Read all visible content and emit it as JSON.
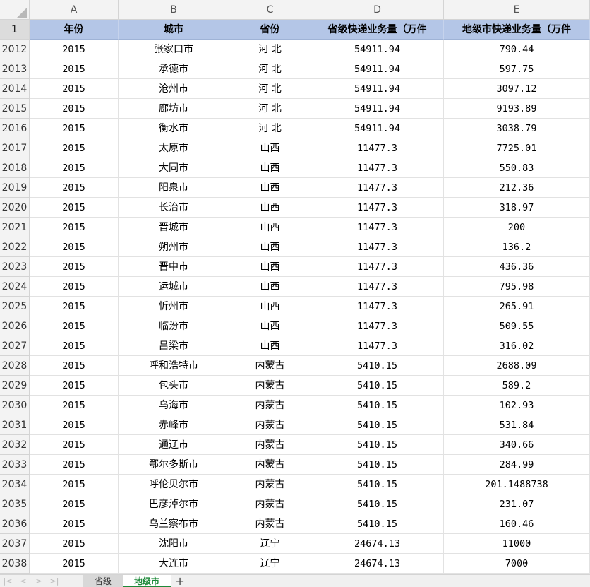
{
  "columns": [
    "A",
    "B",
    "C",
    "D",
    "E"
  ],
  "header": {
    "row_number": "1",
    "cells": [
      "年份",
      "城市",
      "省份",
      "省级快递业务量（万件",
      "地级市快递业务量（万件"
    ]
  },
  "rows": [
    {
      "n": "2012",
      "year": "2015",
      "city": "张家口市",
      "province": "河  北",
      "prov_volume": "54911.94",
      "city_volume": "790.44"
    },
    {
      "n": "2013",
      "year": "2015",
      "city": "承德市",
      "province": "河  北",
      "prov_volume": "54911.94",
      "city_volume": "597.75"
    },
    {
      "n": "2014",
      "year": "2015",
      "city": "沧州市",
      "province": "河  北",
      "prov_volume": "54911.94",
      "city_volume": "3097.12"
    },
    {
      "n": "2015",
      "year": "2015",
      "city": "廊坊市",
      "province": "河  北",
      "prov_volume": "54911.94",
      "city_volume": "9193.89"
    },
    {
      "n": "2016",
      "year": "2015",
      "city": "衡水市",
      "province": "河  北",
      "prov_volume": "54911.94",
      "city_volume": "3038.79"
    },
    {
      "n": "2017",
      "year": "2015",
      "city": "太原市",
      "province": "山西",
      "prov_volume": "11477.3",
      "city_volume": "7725.01"
    },
    {
      "n": "2018",
      "year": "2015",
      "city": "大同市",
      "province": "山西",
      "prov_volume": "11477.3",
      "city_volume": "550.83"
    },
    {
      "n": "2019",
      "year": "2015",
      "city": "阳泉市",
      "province": "山西",
      "prov_volume": "11477.3",
      "city_volume": "212.36"
    },
    {
      "n": "2020",
      "year": "2015",
      "city": "长治市",
      "province": "山西",
      "prov_volume": "11477.3",
      "city_volume": "318.97"
    },
    {
      "n": "2021",
      "year": "2015",
      "city": "晋城市",
      "province": "山西",
      "prov_volume": "11477.3",
      "city_volume": "200"
    },
    {
      "n": "2022",
      "year": "2015",
      "city": "朔州市",
      "province": "山西",
      "prov_volume": "11477.3",
      "city_volume": "136.2"
    },
    {
      "n": "2023",
      "year": "2015",
      "city": "晋中市",
      "province": "山西",
      "prov_volume": "11477.3",
      "city_volume": "436.36"
    },
    {
      "n": "2024",
      "year": "2015",
      "city": "运城市",
      "province": "山西",
      "prov_volume": "11477.3",
      "city_volume": "795.98"
    },
    {
      "n": "2025",
      "year": "2015",
      "city": "忻州市",
      "province": "山西",
      "prov_volume": "11477.3",
      "city_volume": "265.91"
    },
    {
      "n": "2026",
      "year": "2015",
      "city": "临汾市",
      "province": "山西",
      "prov_volume": "11477.3",
      "city_volume": "509.55"
    },
    {
      "n": "2027",
      "year": "2015",
      "city": "吕梁市",
      "province": "山西",
      "prov_volume": "11477.3",
      "city_volume": "316.02"
    },
    {
      "n": "2028",
      "year": "2015",
      "city": "呼和浩特市",
      "province": "内蒙古",
      "prov_volume": "5410.15",
      "city_volume": "2688.09"
    },
    {
      "n": "2029",
      "year": "2015",
      "city": "包头市",
      "province": "内蒙古",
      "prov_volume": "5410.15",
      "city_volume": "589.2"
    },
    {
      "n": "2030",
      "year": "2015",
      "city": "乌海市",
      "province": "内蒙古",
      "prov_volume": "5410.15",
      "city_volume": "102.93"
    },
    {
      "n": "2031",
      "year": "2015",
      "city": "赤峰市",
      "province": "内蒙古",
      "prov_volume": "5410.15",
      "city_volume": "531.84"
    },
    {
      "n": "2032",
      "year": "2015",
      "city": "通辽市",
      "province": "内蒙古",
      "prov_volume": "5410.15",
      "city_volume": "340.66"
    },
    {
      "n": "2033",
      "year": "2015",
      "city": "鄂尔多斯市",
      "province": "内蒙古",
      "prov_volume": "5410.15",
      "city_volume": "284.99"
    },
    {
      "n": "2034",
      "year": "2015",
      "city": "呼伦贝尔市",
      "province": "内蒙古",
      "prov_volume": "5410.15",
      "city_volume": "201.1488738"
    },
    {
      "n": "2035",
      "year": "2015",
      "city": "巴彦淖尔市",
      "province": "内蒙古",
      "prov_volume": "5410.15",
      "city_volume": "231.07"
    },
    {
      "n": "2036",
      "year": "2015",
      "city": "乌兰察布市",
      "province": "内蒙古",
      "prov_volume": "5410.15",
      "city_volume": "160.46"
    },
    {
      "n": "2037",
      "year": "2015",
      "city": "沈阳市",
      "province": "辽宁",
      "prov_volume": "24674.13",
      "city_volume": "11000"
    },
    {
      "n": "2038",
      "year": "2015",
      "city": "大连市",
      "province": "辽宁",
      "prov_volume": "24674.13",
      "city_volume": "7000"
    }
  ],
  "sheet_tabs": {
    "tabs": [
      {
        "label": "省级",
        "active": false
      },
      {
        "label": "地级市",
        "active": true
      }
    ],
    "add_label": "+",
    "nav_icons": [
      "first-sheet-icon",
      "prev-sheet-icon",
      "next-sheet-icon",
      "last-sheet-icon"
    ]
  },
  "colors": {
    "header_fill": "#b4c6e7",
    "active_tab_text": "#1e8a3a",
    "grid_line": "#e2e2e2"
  }
}
